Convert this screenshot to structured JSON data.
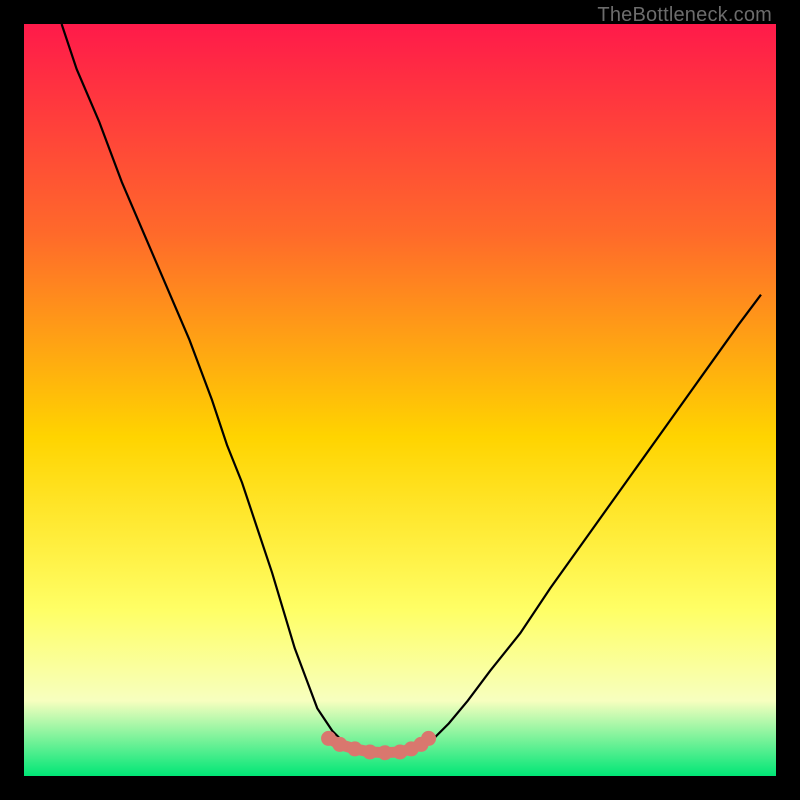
{
  "watermark": "TheBottleneck.com",
  "colors": {
    "gradient_top": "#ff1a4a",
    "gradient_mid1": "#ff6a2a",
    "gradient_mid2": "#ffd400",
    "gradient_mid3": "#ffff66",
    "gradient_mid4": "#f7ffbf",
    "gradient_bottom": "#00e676",
    "curve": "#000000",
    "marker_fill": "#d9776e",
    "marker_stroke": "#d9776e"
  },
  "chart_data": {
    "type": "line",
    "title": "",
    "xlabel": "",
    "ylabel": "",
    "xlim": [
      0,
      100
    ],
    "ylim": [
      0,
      100
    ],
    "curve": {
      "x": [
        5,
        7,
        10,
        13,
        16,
        19,
        22,
        25,
        27,
        29,
        31,
        33,
        34.5,
        36,
        37.5,
        39,
        41,
        43,
        47,
        51,
        53,
        54.5,
        56.5,
        59,
        62,
        66,
        70,
        75,
        80,
        85,
        90,
        95,
        98
      ],
      "y": [
        100,
        94,
        87,
        79,
        72,
        65,
        58,
        50,
        44,
        39,
        33,
        27,
        22,
        17,
        13,
        9,
        6,
        4,
        3,
        3,
        4,
        5,
        7,
        10,
        14,
        19,
        25,
        32,
        39,
        46,
        53,
        60,
        64
      ]
    },
    "markers": {
      "x": [
        40.5,
        42.0,
        44.0,
        46.0,
        48.0,
        50.0,
        51.5,
        52.8,
        53.8
      ],
      "y": [
        5.0,
        4.2,
        3.6,
        3.2,
        3.1,
        3.2,
        3.6,
        4.2,
        5.0
      ]
    }
  }
}
